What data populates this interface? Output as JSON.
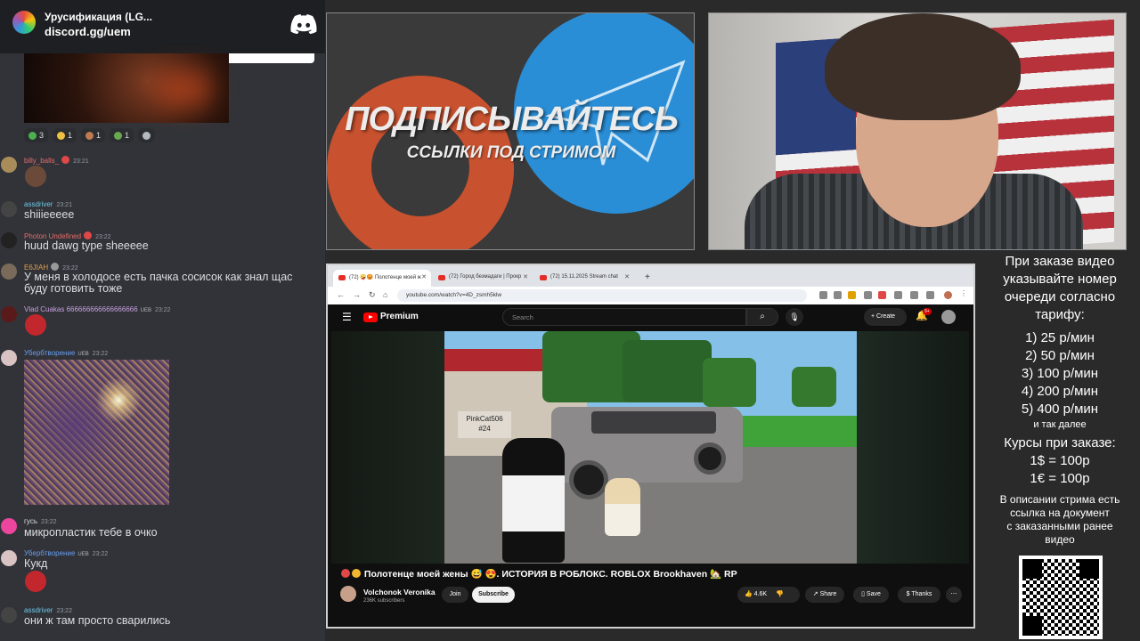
{
  "discord": {
    "server_name": "Урусификация (LG...",
    "invite": "discord.gg/uem",
    "reactions": [
      "3",
      "1",
      "1",
      "1"
    ],
    "messages": [
      {
        "user": "billy_balls_",
        "time": "23:21",
        "text": ""
      },
      {
        "user": "assdriver",
        "time": "23:21",
        "text": "shiiieeeee"
      },
      {
        "user": "Photon Undefined",
        "time": "23:22",
        "text": "huud dawg type sheeeee"
      },
      {
        "user": "E6JIAH",
        "time": "23:22",
        "text": "У меня в холодосе есть пачка сосисок как знал щас",
        "text2": "буду готовить тоже"
      },
      {
        "user": "Vlad Cuakas 666666666666666666",
        "tag": "UEB",
        "time": "23:22",
        "text": ""
      },
      {
        "user": "Убербтворение",
        "tag": "UEB",
        "time": "23:22",
        "text": ""
      },
      {
        "user": "гусь",
        "time": "23:22",
        "text": "микропластик тебе в очко"
      },
      {
        "user": "Убербтворение",
        "tag": "UEB",
        "time": "23:22",
        "text": "Кукд"
      },
      {
        "user": "assdriver",
        "time": "23:22",
        "text": "они ж там просто сварились"
      }
    ]
  },
  "poster": {
    "title": "ПОДПИСЫВАЙТЕСЬ",
    "subtitle": "ССЫЛКИ ПОД СТРИМОМ"
  },
  "browser": {
    "tabs": [
      {
        "label": "(72) 🤪😡 Полотенце моей ж"
      },
      {
        "label": "(72) Город безмадаги | Прокр"
      },
      {
        "label": "(72) 15.11.2025 Stream chat"
      }
    ],
    "url": "youtube.com/watch?v=4D_zsmh5klw"
  },
  "youtube": {
    "brand": "Premium",
    "search_placeholder": "Search",
    "create_label": "Create",
    "notif_count": "9+",
    "video_title": "Полотенце моей жены 😅 😍. ИСТОРИЯ В РОБЛОКС. ROBLOX Brookhaven 🏡 RP",
    "nametag_name": "PinkCat506",
    "nametag_num": "#24",
    "channel": "Volchonok Veronika",
    "subscribers": "236K subscribers",
    "join": "Join",
    "subscribe": "Subscribe",
    "likes": "4.6K",
    "share": "Share",
    "save": "Save",
    "thanks": "Thanks"
  },
  "info": {
    "heading_lines": [
      "При заказе видео",
      "указывайте номер",
      "очереди согласно",
      "тарифу:"
    ],
    "tariffs": [
      "1) 25 р/мин",
      "2) 50 р/мин",
      "3) 100 р/мин",
      "4) 200 р/мин",
      "5) 400 р/мин"
    ],
    "etc": "и так далее",
    "rates_heading": "Курсы при заказе:",
    "rates": [
      "1$ = 100р",
      "1€ = 100р"
    ],
    "footer_lines": [
      "В описании стрима есть",
      "ссылка на документ",
      "с заказанными ранее",
      "видео"
    ]
  },
  "colors": {
    "discord_bg": "#313338",
    "discord_header": "#1e1f22",
    "yt_bg": "#0f0f0f",
    "yt_red": "#ff0000",
    "poster_bg": "#3a3a3a",
    "patreon_orange": "#c8522f",
    "telegram_blue": "#2a8ed6"
  }
}
